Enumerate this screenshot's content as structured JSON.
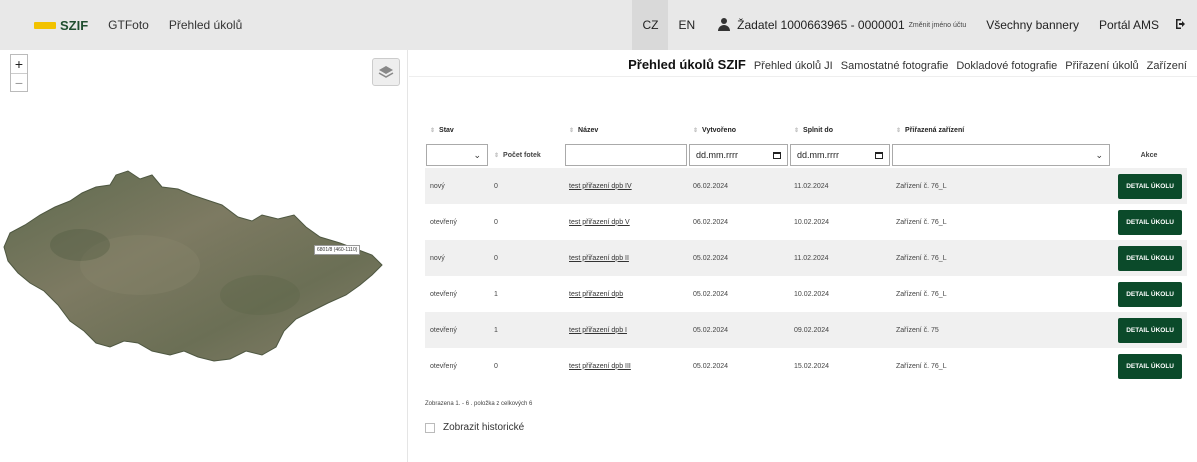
{
  "app": {
    "logo": "SZIF",
    "nav": [
      "GTFoto",
      "Přehled úkolů"
    ]
  },
  "topbar": {
    "languages": [
      "CZ",
      "EN"
    ],
    "user": "Žadatel 1000663965 - 0000001",
    "change_name": "Změnit jméno účtu",
    "links": [
      "Všechny bannery",
      "Portál AMS"
    ],
    "logout_icon": "logout-icon"
  },
  "map": {
    "zoom_in": "+",
    "zoom_out": "−",
    "feature_label": "6801/8 (460-1110)"
  },
  "subnav": [
    "Přehled úkolů SZIF",
    "Přehled úkolů JI",
    "Samostatné fotografie",
    "Dokladové fotografie",
    "Přiřazení úkolů",
    "Zařízení"
  ],
  "table": {
    "headers": [
      "Stav",
      "Počet fotek",
      "Název",
      "Vytvořeno",
      "Splnit do",
      "Přiřazená zařízení",
      "Akce"
    ],
    "filters": {
      "created": "dd.mm.rrrr",
      "due": "dd.mm.rrrr"
    },
    "rows": [
      {
        "status": "nový",
        "photos": "0",
        "name": "test přiřazení dpb IV",
        "created": "06.02.2024",
        "due": "11.02.2024",
        "devices": "Zařízení č. 76_L",
        "action": "DETAIL ÚKOLU"
      },
      {
        "status": "otevřený",
        "photos": "0",
        "name": "test přiřazení dpb V",
        "created": "06.02.2024",
        "due": "10.02.2024",
        "devices": "Zařízení č. 76_L",
        "action": "DETAIL ÚKOLU"
      },
      {
        "status": "nový",
        "photos": "0",
        "name": "test přiřazení dpb II",
        "created": "05.02.2024",
        "due": "11.02.2024",
        "devices": "Zařízení č. 76_L",
        "action": "DETAIL ÚKOLU"
      },
      {
        "status": "otevřený",
        "photos": "1",
        "name": "test přiřazení dpb",
        "created": "05.02.2024",
        "due": "10.02.2024",
        "devices": "Zařízení č. 76_L",
        "action": "DETAIL ÚKOLU"
      },
      {
        "status": "otevřený",
        "photos": "1",
        "name": "test přiřazení dpb I",
        "created": "05.02.2024",
        "due": "09.02.2024",
        "devices": "Zařízení č. 75",
        "action": "DETAIL ÚKOLU"
      },
      {
        "status": "otevřený",
        "photos": "0",
        "name": "test přiřazení dpb III",
        "created": "05.02.2024",
        "due": "15.02.2024",
        "devices": "Zařízení č. 76_L",
        "action": "DETAIL ÚKOLU"
      }
    ]
  },
  "footer": {
    "info": "Zobrazena 1. - 6 . položka z celkových 6",
    "show_history": "Zobrazit historické"
  },
  "colors": {
    "accent": "#0b4a2a",
    "logo_yellow": "#f2c200"
  }
}
